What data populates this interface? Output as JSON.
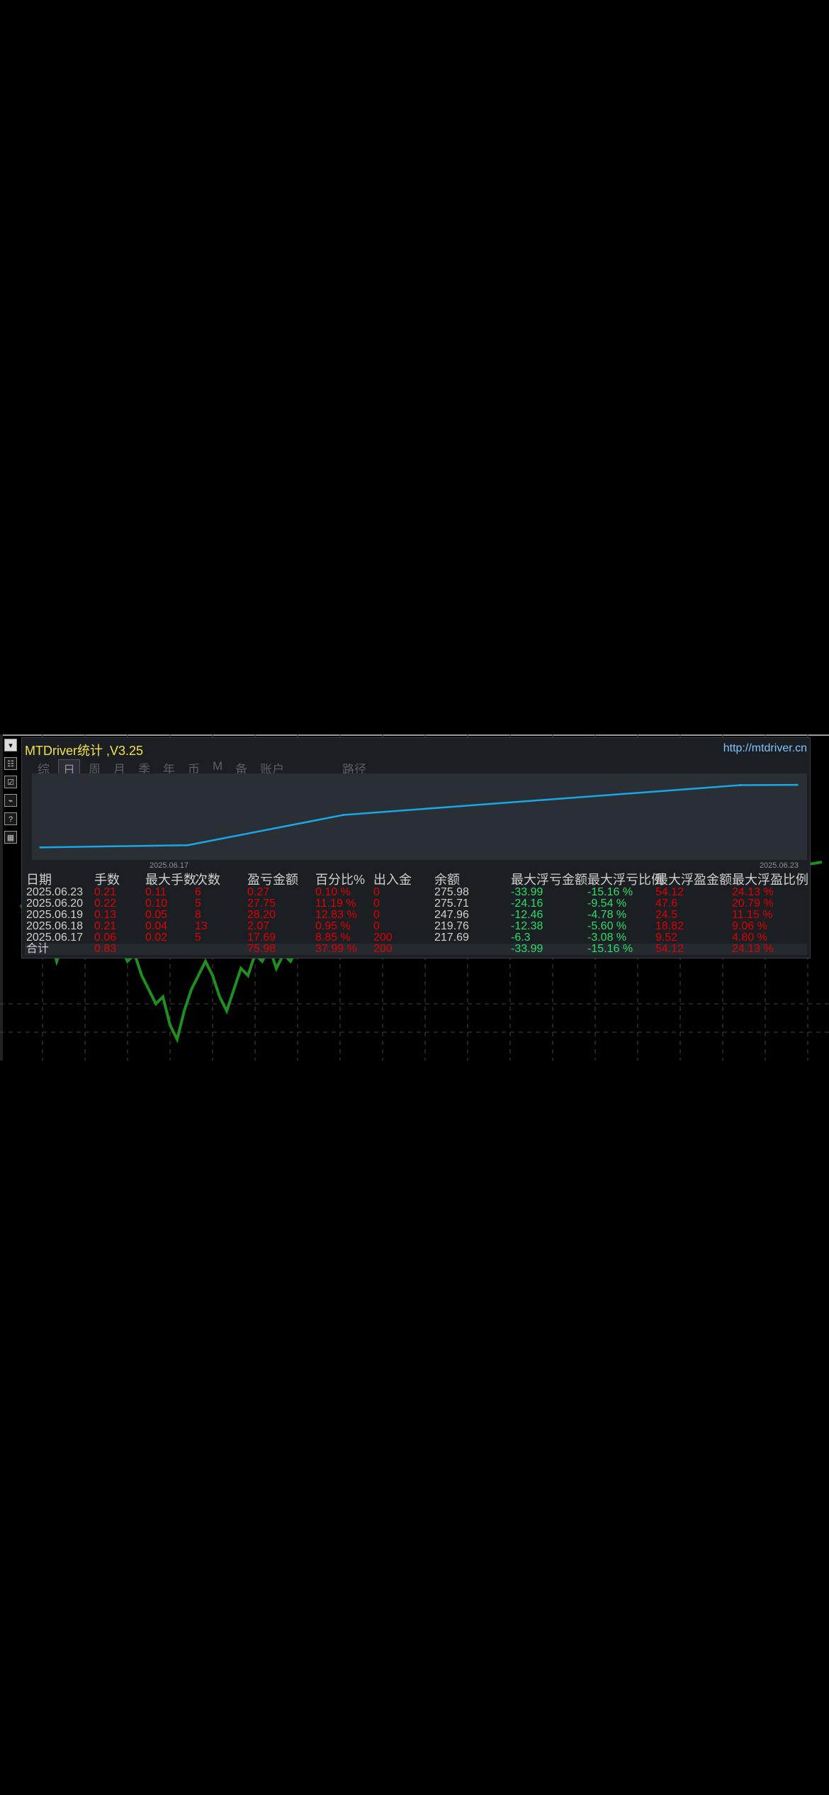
{
  "window": {
    "title": "MTDriver统计 ,V3.25",
    "url": "http://mtdriver.cn"
  },
  "toolbar": {
    "items": [
      {
        "icon": "dropdown-icon",
        "label": "▾"
      },
      {
        "icon": "stats-icon",
        "label": "☷"
      },
      {
        "icon": "checkbox-icon",
        "label": "☑"
      },
      {
        "icon": "line-chart-icon",
        "label": "⌁"
      },
      {
        "icon": "help-icon",
        "label": "?"
      },
      {
        "icon": "table-icon",
        "label": "▦"
      }
    ]
  },
  "tabs": [
    {
      "label": "综",
      "active": false
    },
    {
      "label": "日",
      "active": true
    },
    {
      "label": "周",
      "active": false
    },
    {
      "label": "月",
      "active": false
    },
    {
      "label": "季",
      "active": false
    },
    {
      "label": "年",
      "active": false
    },
    {
      "label": "币",
      "active": false
    },
    {
      "label": "M",
      "active": false
    },
    {
      "label": "备",
      "active": false
    },
    {
      "label": "账户",
      "active": false
    },
    {
      "label": "路径",
      "active": false
    }
  ],
  "chart": {
    "date_start": "2025.06.17",
    "date_end": "2025.06.23"
  },
  "chart_data": {
    "type": "line",
    "x": [
      "2025.06.17",
      "2025.06.18",
      "2025.06.19",
      "2025.06.20",
      "2025.06.23"
    ],
    "series": [
      {
        "values": [
          217.69,
          219.76,
          247.96,
          275.71,
          275.98
        ]
      }
    ],
    "ylim": [
      210,
      280
    ],
    "color": "#1aa7e8"
  },
  "table": {
    "headers": [
      "日期",
      "手数",
      "最大手数",
      "次数",
      "盈亏金额",
      "百分比%",
      "出入金",
      "余额",
      "最大浮亏金额",
      "最大浮亏比例",
      "最大浮盈金额",
      "最大浮盈比例"
    ],
    "rows": [
      [
        "2025.06.23",
        "0.21",
        "0.11",
        "6",
        "0.27",
        "0.10 %",
        "0",
        "275.98",
        "-33.99",
        "-15.16 %",
        "54.12",
        "24.13 %"
      ],
      [
        "2025.06.20",
        "0.22",
        "0.10",
        "5",
        "27.75",
        "11.19 %",
        "0",
        "275.71",
        "-24.16",
        "-9.54 %",
        "47.6",
        "20.79 %"
      ],
      [
        "2025.06.19",
        "0.13",
        "0.05",
        "8",
        "28.20",
        "12.83 %",
        "0",
        "247.96",
        "-12.46",
        "-4.78 %",
        "24.5",
        "11.15 %"
      ],
      [
        "2025.06.18",
        "0.21",
        "0.04",
        "13",
        "2.07",
        "0.95 %",
        "0",
        "219.76",
        "-12.38",
        "-5.60 %",
        "18.82",
        "9.06 %"
      ],
      [
        "2025.06.17",
        "0.06",
        "0.02",
        "5",
        "17.69",
        "8.85 %",
        "200",
        "217.69",
        "-6.3",
        "-3.08 %",
        "9.52",
        "4.80 %"
      ]
    ],
    "total": [
      "合计",
      "0.83",
      "",
      "",
      "75.98",
      "37.99 %",
      "200",
      "",
      "-33.99",
      "-15.16 %",
      "54.12",
      "24.13 %"
    ]
  },
  "colors": {
    "title": "#f2e24a",
    "url": "#7fc6ff",
    "line": "#1aa7e8",
    "red": "#e00000",
    "green": "#2adf66"
  }
}
